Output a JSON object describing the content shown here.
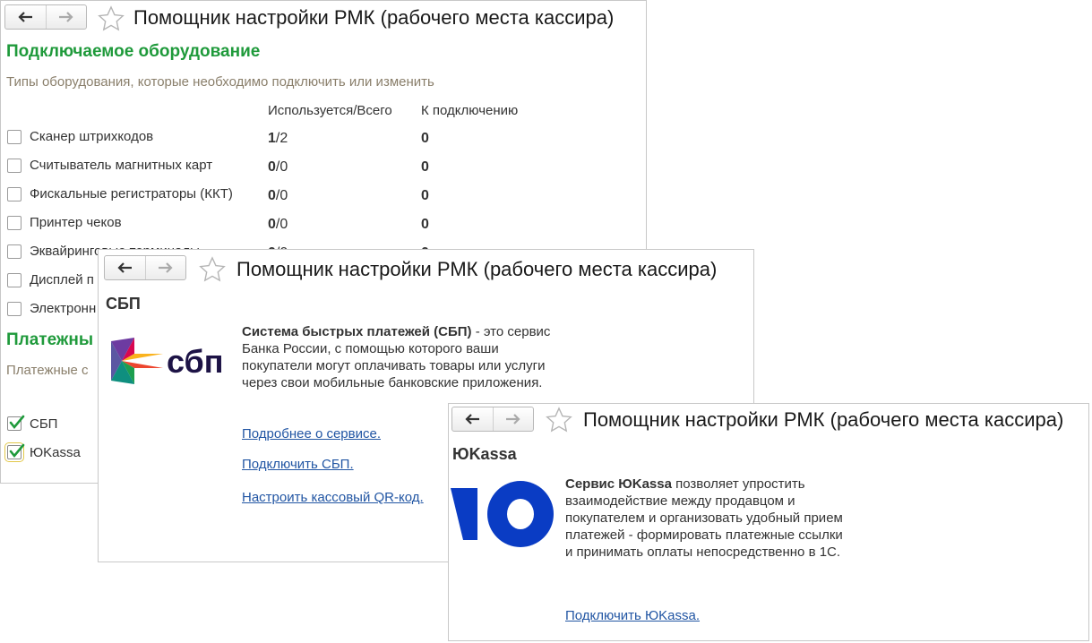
{
  "window1": {
    "title": "Помощник настройки РМК (рабочего места кассира)",
    "section_equipment": "Подключаемое оборудование",
    "equipment_hint": "Типы оборудования, которые необходимо подключить или изменить",
    "col_used": "Используется/Всего",
    "col_to_connect": "К подключению",
    "equipment": [
      {
        "label": "Сканер штрихкодов",
        "used": "1",
        "total": "/2",
        "to_connect": "0",
        "checked": false
      },
      {
        "label": "Считыватель магнитных карт",
        "used": "0",
        "total": "/0",
        "to_connect": "0",
        "checked": false
      },
      {
        "label": "Фискальные регистраторы (ККТ)",
        "used": "0",
        "total": "/0",
        "to_connect": "0",
        "checked": false
      },
      {
        "label": "Принтер чеков",
        "used": "0",
        "total": "/0",
        "to_connect": "0",
        "checked": false
      },
      {
        "label": "Эквайринговые терминалы",
        "used": "0",
        "total": "/0",
        "to_connect": "0",
        "checked": false
      },
      {
        "label": "Дисплей п",
        "checked": false
      },
      {
        "label": "Электронн",
        "checked": false
      }
    ],
    "section_payment": "Платежны",
    "payment_hint": "Платежные с",
    "payments": [
      {
        "label": "СБП",
        "checked": true
      },
      {
        "label": "ЮKassa",
        "checked": true
      }
    ]
  },
  "window2": {
    "title": "Помощник настройки РМК (рабочего места кассира)",
    "section": "СБП",
    "logo_text": "сбп",
    "desc_bold": "Система быстрых платежей (СБП)",
    "desc_rest": " - это сервис Банка России, с помощью которого ваши покупатели могут оплачивать товары или услуги через свои мобильные банковские приложения.",
    "link_more": "Подробнее о сервисе.",
    "link_connect": "Подключить СБП.",
    "link_qr": "Настроить кассовый QR-код."
  },
  "window3": {
    "title": "Помощник настройки РМК (рабочего места кассира)",
    "section": "ЮKassa",
    "desc_bold": "Сервис ЮKassa",
    "desc_rest": " позволяет упростить взаимодействие между продавцом и покупателем и организовать удобный прием платежей - формировать платежные ссылки и принимать оплаты непосредственно в 1С.",
    "link_connect": "Подключить ЮKassa."
  },
  "colors": {
    "green_heading": "#1f9a3b",
    "hint": "#8a7f6b",
    "link": "#2155a3",
    "check": "#1f9a3b",
    "yukassa_blue": "#0a3cc4"
  },
  "icons": {
    "back": "arrow-left-icon",
    "forward": "arrow-right-icon",
    "favorite": "star-outline-icon",
    "checkmark": "check-icon"
  }
}
